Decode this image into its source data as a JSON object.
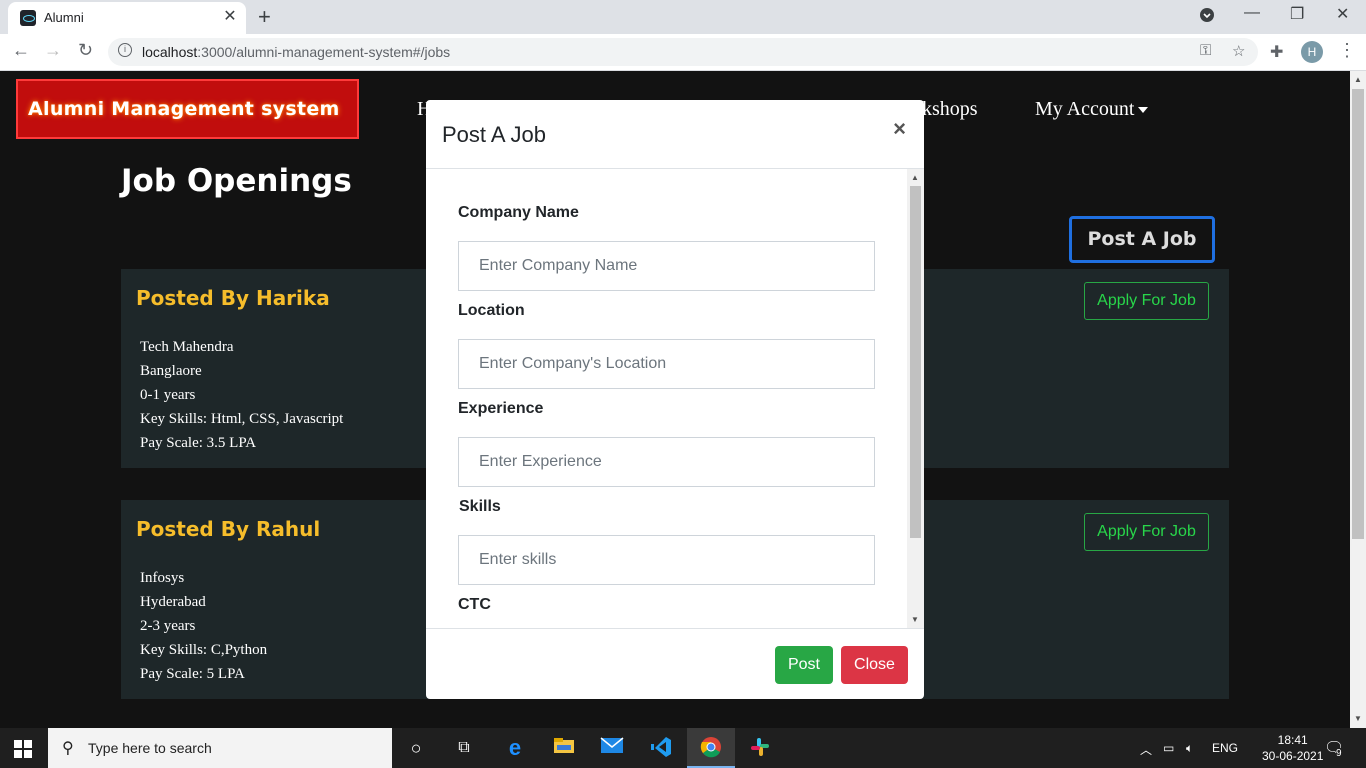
{
  "browser": {
    "tab_title": "Alumni",
    "url_host": "localhost",
    "url_path": ":3000/alumni-management-system#/jobs",
    "profile_initial": "H"
  },
  "site": {
    "logo_text": "Alumni Management system",
    "nav": {
      "partial_left": "H",
      "partial_right": "kshops",
      "account": "My Account"
    },
    "heading": "Job Openings",
    "post_job_button": "Post A Job",
    "jobs": [
      {
        "posted_by": "Posted By Harika",
        "apply_label": "Apply For Job",
        "company": "Tech Mahendra",
        "location": "Banglaore",
        "experience": "0-1 years",
        "skills": "Key Skills: Html, CSS, Javascript",
        "pay": "Pay Scale: 3.5 LPA"
      },
      {
        "posted_by": "Posted By Rahul",
        "apply_label": "Apply For Job",
        "company": "Infosys",
        "location": "Hyderabad",
        "experience": "2-3 years",
        "skills": "Key Skills: C,Python",
        "pay": "Pay Scale: 5 LPA"
      }
    ]
  },
  "modal": {
    "title": "Post A Job",
    "close_symbol": "×",
    "fields": [
      {
        "label": "Company Name",
        "placeholder": "Enter Company Name"
      },
      {
        "label": "Location",
        "placeholder": "Enter Company's Location"
      },
      {
        "label": "Experience",
        "placeholder": "Enter Experience"
      },
      {
        "label": "Skills",
        "placeholder": "Enter skills"
      },
      {
        "label": "CTC"
      }
    ],
    "post_label": "Post",
    "close_label": "Close"
  },
  "taskbar": {
    "search_placeholder": "Type here to search",
    "language": "ENG",
    "time": "18:41",
    "date": "30-06-2021",
    "notifications": "9"
  },
  "colors": {
    "posted_by": "#f6bd2b",
    "apply": "#28a745",
    "post_button": "#28a745",
    "close_button": "#dc3545",
    "logo_bg": "#c10d0d"
  }
}
